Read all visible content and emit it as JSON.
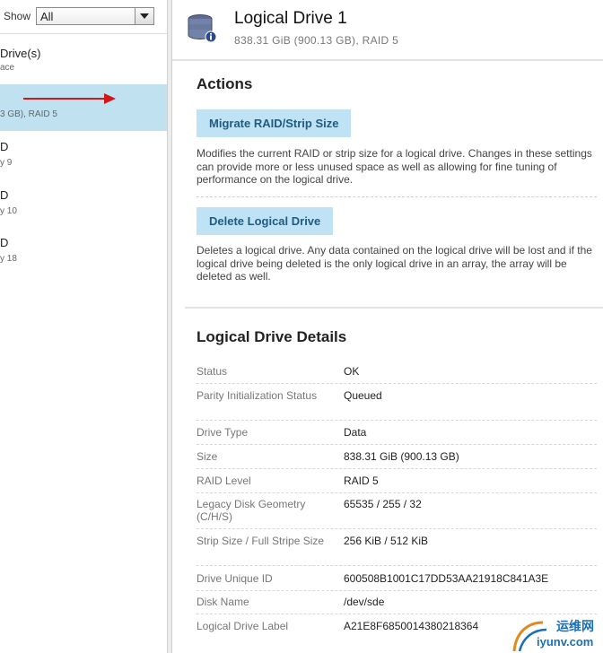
{
  "filter": {
    "label": "Show",
    "value": "All"
  },
  "left_nav": [
    {
      "title": "Drive(s)",
      "subtitle": "ace"
    },
    {
      "title": "",
      "subtitle": "3 GB), RAID 5",
      "selected": true
    },
    {
      "title": "D",
      "subtitle": "y 9"
    },
    {
      "title": "D",
      "subtitle": "y 10"
    },
    {
      "title": "D",
      "subtitle": "y 18"
    }
  ],
  "header": {
    "title": "Logical Drive 1",
    "subtitle": "838.31 GiB (900.13 GB), RAID 5",
    "icon": "database-icon"
  },
  "actions": {
    "title": "Actions",
    "items": [
      {
        "label": "Migrate RAID/Strip Size",
        "description": "Modifies the current RAID or strip size for a logical drive. Changes in these settings can provide more or less unused space as well as allowing for fine tuning of performance on the logical drive."
      },
      {
        "label": "Delete Logical Drive",
        "description": "Deletes a logical drive. Any data contained on the logical drive will be lost and if the logical drive being deleted is the only logical drive in an array, the array will be deleted as well."
      }
    ]
  },
  "details": {
    "title": "Logical Drive Details",
    "rows": [
      {
        "key": "Status",
        "value": "OK"
      },
      {
        "key": "Parity Initialization Status",
        "value": "Queued"
      },
      {
        "key": "Drive Type",
        "value": "Data"
      },
      {
        "key": "Size",
        "value": "838.31 GiB (900.13 GB)"
      },
      {
        "key": "RAID Level",
        "value": "RAID 5"
      },
      {
        "key": "Legacy Disk Geometry (C/H/S)",
        "value": "65535 / 255 / 32"
      },
      {
        "key": "Strip Size / Full Stripe Size",
        "value": "256 KiB / 512 KiB"
      },
      {
        "key": "Drive Unique ID",
        "value": "600508B1001C17DD53AA21918C841A3E"
      },
      {
        "key": "Disk Name",
        "value": "/dev/sde"
      },
      {
        "key": "Logical Drive Label",
        "value": "A21E8F6850014380218364"
      }
    ]
  },
  "watermark": {
    "line1": "运维网",
    "line2": "iyunv.com"
  },
  "colors": {
    "accent": "#bfe3f5",
    "selected": "#bfe1f0",
    "arrow": "#d01818",
    "button_text": "#1f5b82"
  }
}
